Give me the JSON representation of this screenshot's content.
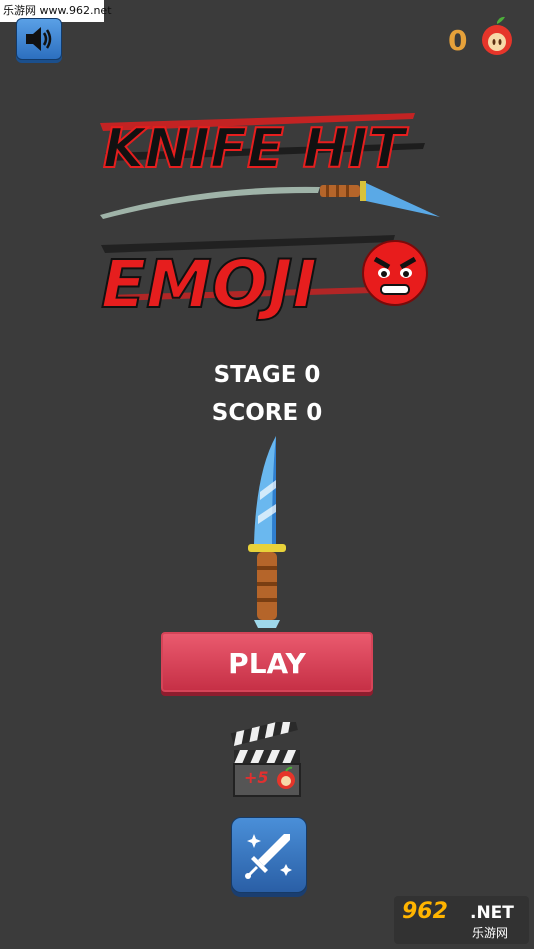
{
  "watermark": {
    "top_text": "乐游网 www.962.net",
    "bottom_logo": "962",
    "bottom_net": ".NET",
    "bottom_sub": "乐游网"
  },
  "header": {
    "sound_icon": "speaker-icon",
    "apple_count": "0",
    "apple_icon": "apple-icon"
  },
  "logo": {
    "line1": "KNIFE HIT",
    "line2": "EMOJI",
    "emoji_icon": "angry-emoji-icon",
    "title_color": "#e61e1e"
  },
  "stats": {
    "stage_label": "STAGE 0",
    "score_label": "SCORE 0"
  },
  "center_knife_icon": "knife-icon",
  "play_button": {
    "label": "PLAY",
    "color": "#d63a50"
  },
  "reward": {
    "clapper_icon": "clapperboard-icon",
    "bonus_text": "+5"
  },
  "sword_button_icon": "sword-sparkle-icon"
}
